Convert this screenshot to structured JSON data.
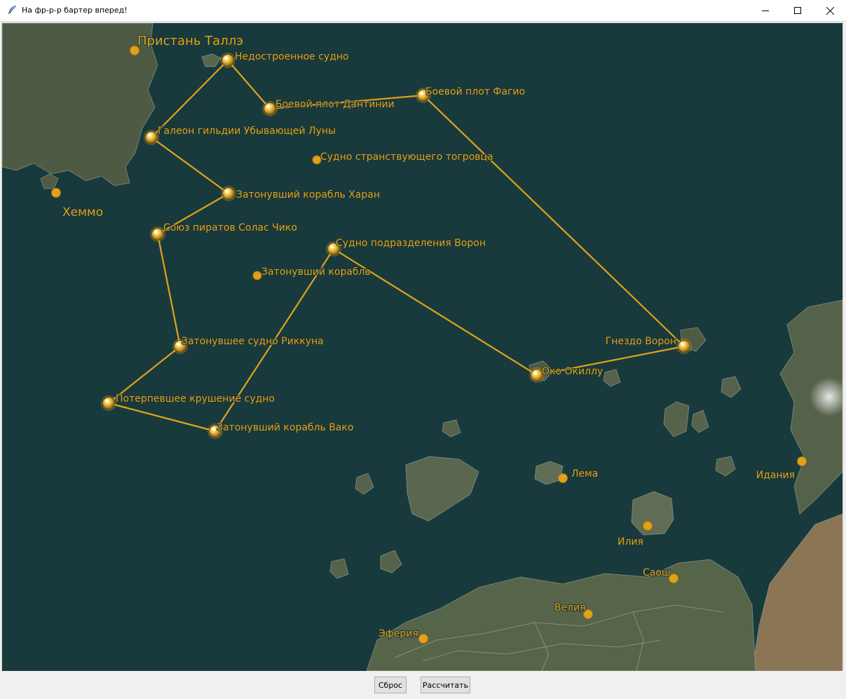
{
  "window": {
    "title": "На фр-р-р бартер вперед!"
  },
  "map": {
    "route": [
      "Недостроенное судно",
      "Боевой плот Дантинии",
      "Боевой плот Фагио",
      "Гнездо Ворон",
      "Око Окиллу",
      "Судно подразделения Ворон",
      "Затонувший корабль Вако",
      "Потерпевшее крушение судно",
      "Затонувшее судно Риккуна",
      "Союз пиратов Солас Чико",
      "Затонувший корабль Харан",
      "Галеон гильдии Убывающей Луны",
      "Недостроенное судно"
    ],
    "ship_waypoints": [
      {
        "id": "unfinished",
        "name": "Недостроенное судно"
      },
      {
        "id": "dantinia",
        "name": "Боевой плот Дантинии"
      },
      {
        "id": "fagio",
        "name": "Боевой плот Фагио"
      },
      {
        "id": "galleon",
        "name": "Галеон гильдии Убывающей Луны"
      },
      {
        "id": "haran",
        "name": "Затонувший корабль Харан"
      },
      {
        "id": "solas",
        "name": "Союз пиратов Солас Чико"
      },
      {
        "id": "raven_unit",
        "name": "Судно подразделения Ворон"
      },
      {
        "id": "rikkun",
        "name": "Затонувшее судно Риккуна"
      },
      {
        "id": "wrecked",
        "name": "Потерпевшее крушение судно"
      },
      {
        "id": "vako",
        "name": "Затонувший корабль Вако"
      },
      {
        "id": "okillu",
        "name": "Око Окиллу"
      },
      {
        "id": "raven_nest",
        "name": "Гнездо Ворон"
      }
    ],
    "unselected_points": [
      {
        "id": "merchant",
        "name": "Судно странствующего тогровца"
      },
      {
        "id": "sunken",
        "name": "Затонувший корабль"
      }
    ],
    "towns": [
      {
        "id": "talle",
        "name": "Пристань Таллэ"
      },
      {
        "id": "hemmo",
        "name": "Хеммо"
      },
      {
        "id": "lema",
        "name": "Лема"
      },
      {
        "id": "idania",
        "name": "Идания"
      },
      {
        "id": "ilia",
        "name": "Илия"
      },
      {
        "id": "saosh",
        "name": "Саош"
      },
      {
        "id": "velia",
        "name": "Велия"
      },
      {
        "id": "eferia",
        "name": "Эферия"
      }
    ],
    "colors": {
      "sea": "#183a3d",
      "route_line": "#e0a21a",
      "label": "#e0a21a",
      "land": "#5d6a4b"
    }
  },
  "buttons": {
    "reset_label": "Сброс",
    "calculate_label": "Рассчитать"
  }
}
